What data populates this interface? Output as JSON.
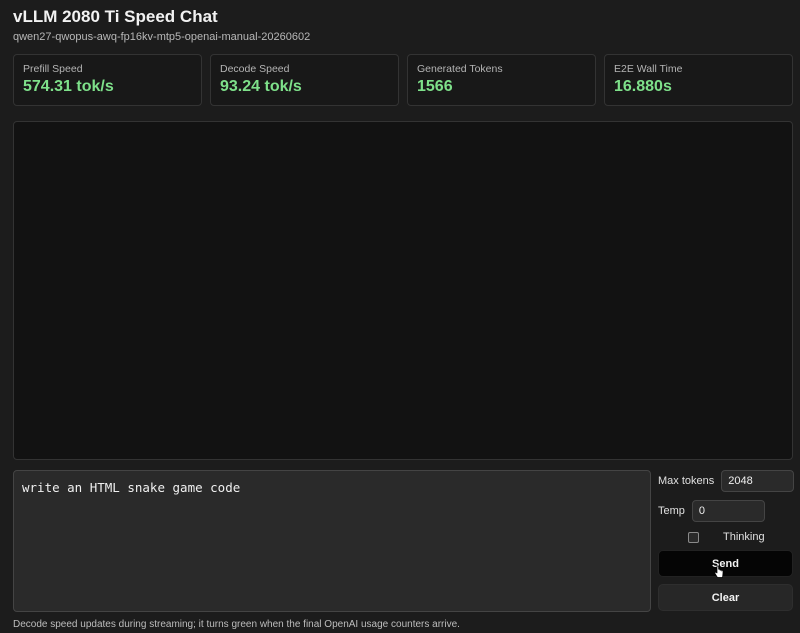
{
  "header": {
    "title": "vLLM 2080 Ti Speed Chat",
    "model": "qwen27-qwopus-awq-fp16kv-mtp5-openai-manual-20260602"
  },
  "stats": [
    {
      "label": "Prefill Speed",
      "value": "574.31 tok/s"
    },
    {
      "label": "Decode Speed",
      "value": "93.24 tok/s"
    },
    {
      "label": "Generated Tokens",
      "value": "1566"
    },
    {
      "label": "E2E Wall Time",
      "value": "16.880s"
    }
  ],
  "prompt": {
    "value": "write an HTML snake game code"
  },
  "controls": {
    "max_tokens_label": "Max tokens",
    "max_tokens_value": "2048",
    "temp_label": "Temp",
    "temp_value": "0",
    "thinking_label": "Thinking",
    "thinking_checked": false,
    "send_label": "Send",
    "clear_label": "Clear"
  },
  "footer": {
    "note": "Decode speed updates during streaming; it turns green when the final OpenAI usage counters arrive."
  },
  "colors": {
    "background": "#1c1c1c",
    "stat_value": "#7ee08a",
    "send_button": "#050505"
  },
  "icons": {
    "cursor": "pointer-hand-icon"
  }
}
